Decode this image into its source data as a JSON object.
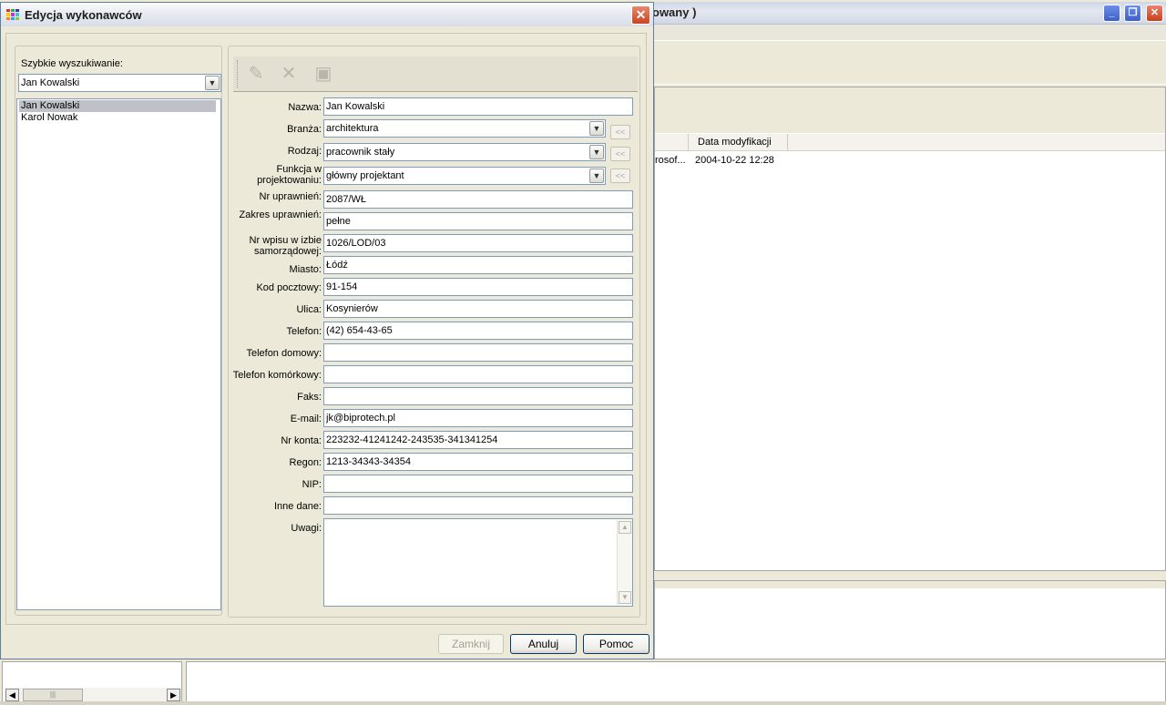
{
  "background": {
    "title_fragment": "owany )",
    "column_header": "Data modyfikacji",
    "row_cell_1": "rosof...",
    "row_cell_2": "2004-10-22 12:28"
  },
  "dialog": {
    "title": "Edycja wykonawców",
    "search_label": "Szybkie wyszukiwanie:",
    "search_value": "Jan Kowalski",
    "list_items": [
      "Jan Kowalski",
      "Karol Nowak"
    ],
    "fields": {
      "nazwa": {
        "label": "Nazwa:",
        "value": "Jan Kowalski"
      },
      "branza": {
        "label": "Branża:",
        "value": "architektura"
      },
      "rodzaj": {
        "label": "Rodzaj:",
        "value": "pracownik stały"
      },
      "funkcja": {
        "label_line1": "Funkcja w",
        "label_line2": "projektowaniu:",
        "value": "główny projektant"
      },
      "nr_uprawnien": {
        "label": "Nr uprawnień:",
        "value": "2087/WŁ"
      },
      "zakres_uprawnien": {
        "label": "Zakres uprawnień:",
        "value": "pełne"
      },
      "nr_wpisu": {
        "label_line1": "Nr wpisu w izbie",
        "label_line2": "samorządowej:",
        "value": "1026/LOD/03"
      },
      "miasto": {
        "label": "Miasto:",
        "value": "Łódź"
      },
      "kod_pocztowy": {
        "label": "Kod pocztowy:",
        "value": "91-154"
      },
      "ulica": {
        "label": "Ulica:",
        "value": "Kosynierów"
      },
      "telefon": {
        "label": "Telefon:",
        "value": "(42) 654-43-65"
      },
      "telefon_domowy": {
        "label": "Telefon domowy:",
        "value": ""
      },
      "telefon_komorkowy": {
        "label": "Telefon komórkowy:",
        "value": ""
      },
      "faks": {
        "label": "Faks:",
        "value": ""
      },
      "email": {
        "label": "E-mail:",
        "value": "jk@biprotech.pl"
      },
      "nr_konta": {
        "label": "Nr konta:",
        "value": "223232-41241242-243535-341341254"
      },
      "regon": {
        "label": "Regon:",
        "value": "1213-34343-34354"
      },
      "nip": {
        "label": "NIP:",
        "value": ""
      },
      "inne_dane": {
        "label": "Inne dane:",
        "value": ""
      },
      "uwagi": {
        "label": "Uwagi:",
        "value": ""
      }
    },
    "history_button": "<<",
    "buttons": {
      "close": "Zamknij",
      "cancel": "Anuluj",
      "help": "Pomoc"
    },
    "toolbar_icons": [
      "edit-icon",
      "delete-icon",
      "save-icon"
    ]
  },
  "colors": {
    "dialog_bg": "#ece9d8",
    "title_close_red": "#c94423",
    "input_border": "#7f9db9",
    "list_selection": "#c0c0c8"
  }
}
